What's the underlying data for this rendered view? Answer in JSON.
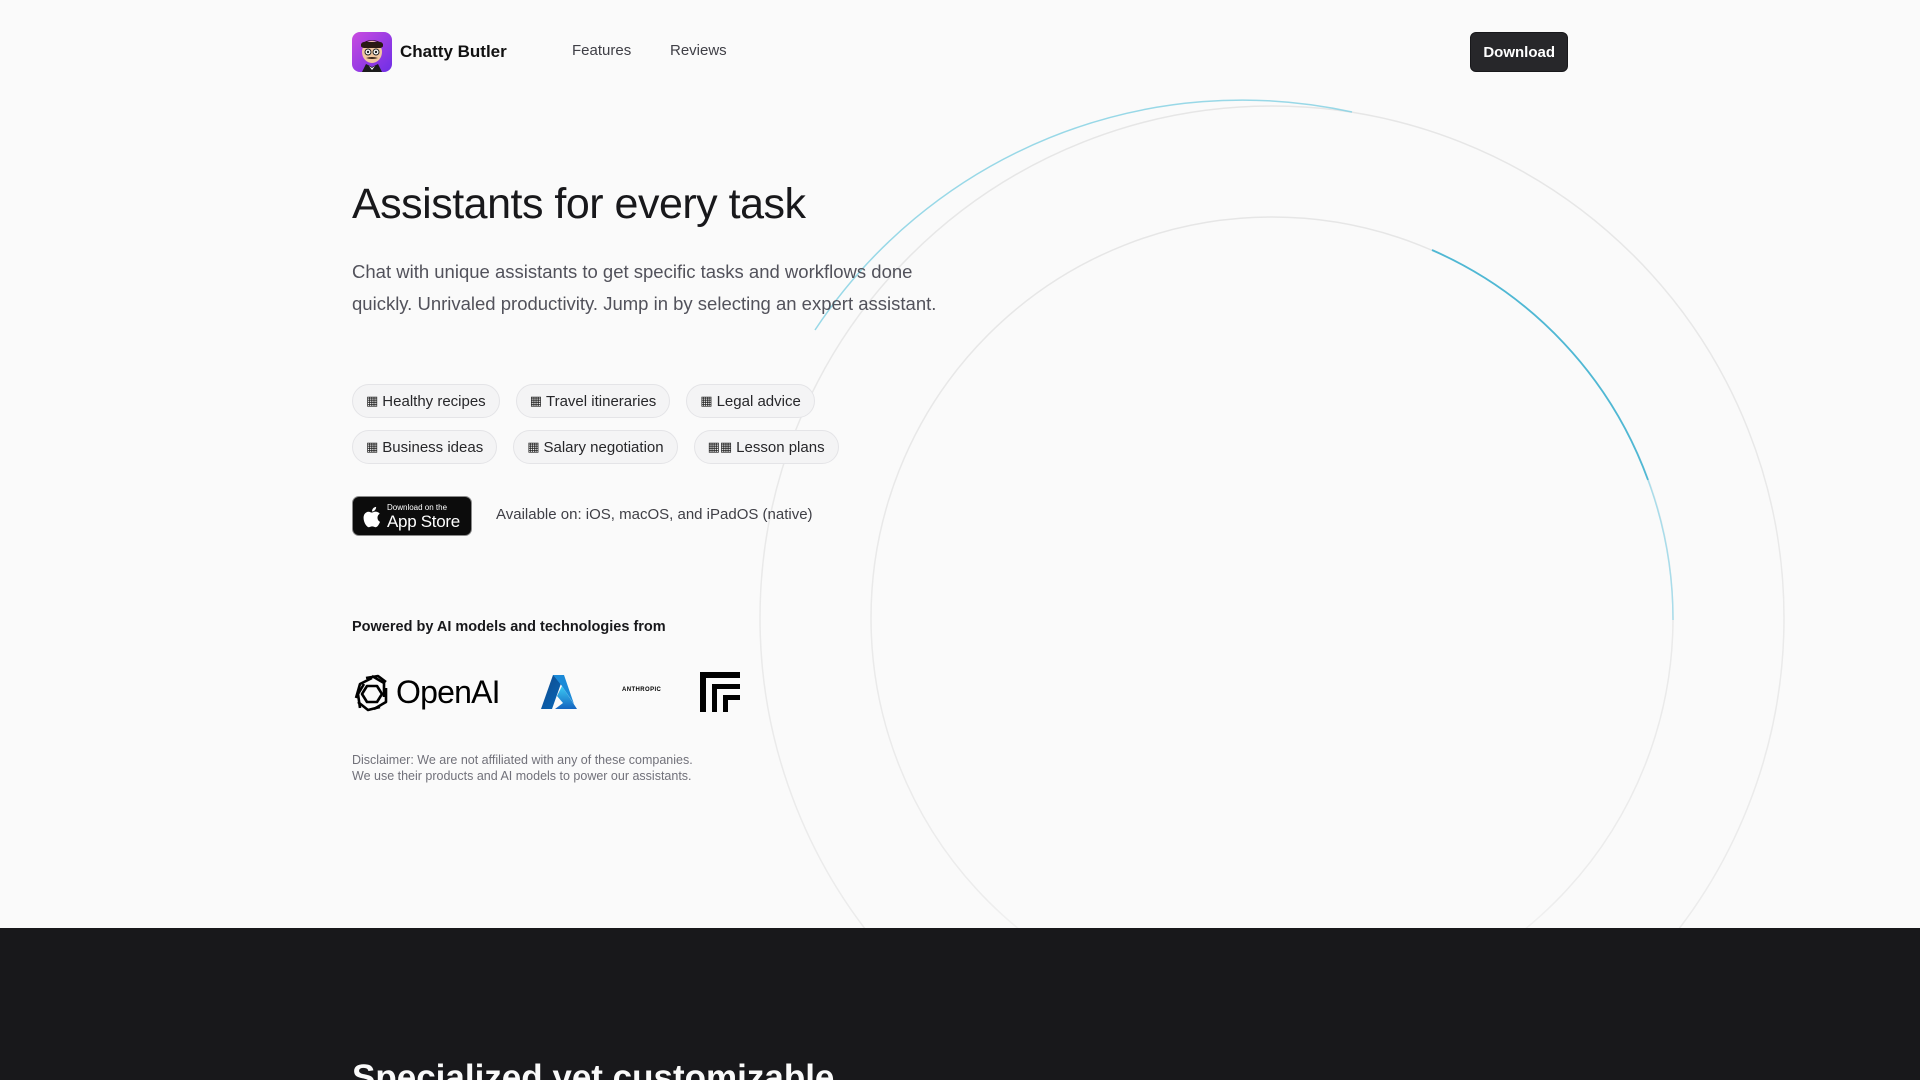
{
  "nav": {
    "brand_name": "Chatty Butler",
    "links": [
      {
        "label": "Features"
      },
      {
        "label": "Reviews"
      }
    ],
    "download_label": "Download"
  },
  "hero": {
    "title": "Assistants for every task",
    "description": "Chat with unique assistants to get specific tasks and workflows done quickly. Unrivaled productivity. Jump in by selecting an expert assistant.",
    "chips": [
      {
        "emoji": "▦",
        "label": "Healthy recipes"
      },
      {
        "emoji": "▦",
        "label": "Travel itineraries"
      },
      {
        "emoji": "▦",
        "label": "Legal advice"
      },
      {
        "emoji": "▦",
        "label": "Business ideas"
      },
      {
        "emoji": "▦",
        "label": "Salary negotiation"
      },
      {
        "emoji": "▦▦",
        "label": "Lesson plans"
      }
    ],
    "app_store": {
      "small": "Download on the",
      "big": "App Store"
    },
    "available": "Available on: iOS, macOS, and iPadOS (native)"
  },
  "powered": {
    "heading": "Powered by AI models and technologies from",
    "logos": [
      {
        "name": "OpenAI",
        "icon": "openai-icon"
      },
      {
        "name": "Azure",
        "icon": "azure-icon"
      },
      {
        "name": "ANTHROPIC",
        "icon": "anthropic-wordmark"
      },
      {
        "name": "Replicate",
        "icon": "replicate-icon"
      }
    ],
    "disclaimer_1": "Disclaimer: We are not affiliated with any of these companies.",
    "disclaimer_2": "We use their products and AI models to power our assistants."
  },
  "section2": {
    "title": "Specialized yet customizable"
  },
  "colors": {
    "accent_ring": "#4fb8d4",
    "dark_bg": "#18181b",
    "button_bg": "#27272a"
  }
}
